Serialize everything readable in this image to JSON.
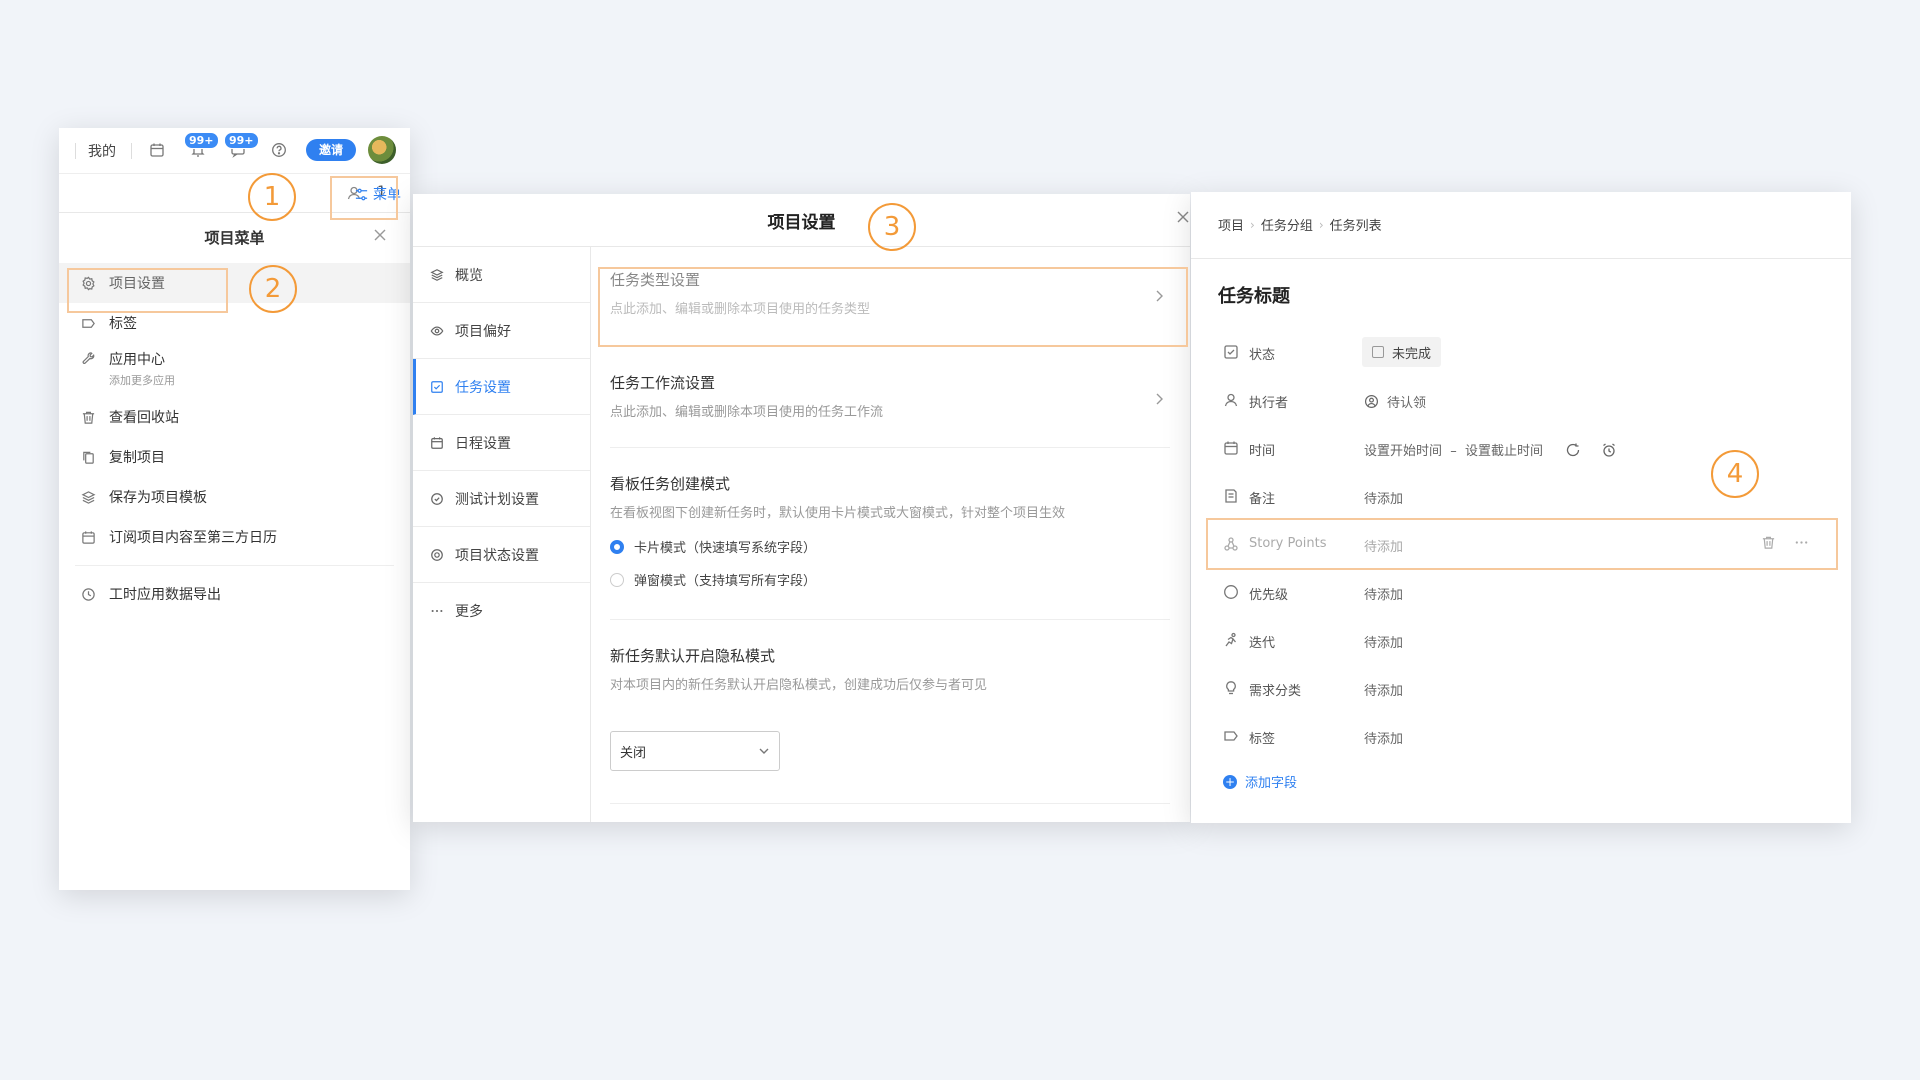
{
  "topbar": {
    "mine_label": "我的",
    "badge1": "99+",
    "badge2": "99+",
    "invite_label": "邀请"
  },
  "subbar": {
    "member_count": "1",
    "menu_label": "菜单"
  },
  "project_menu": {
    "title": "项目菜单",
    "items": [
      {
        "label": "项目设置",
        "icon": "gear-icon"
      },
      {
        "label": "标签",
        "icon": "tag-icon"
      },
      {
        "label": "应用中心",
        "sub": "添加更多应用",
        "icon": "wrench-icon"
      },
      {
        "label": "查看回收站",
        "icon": "trash-icon"
      },
      {
        "label": "复制项目",
        "icon": "copy-icon"
      },
      {
        "label": "保存为项目模板",
        "icon": "layers-icon"
      },
      {
        "label": "订阅项目内容至第三方日历",
        "icon": "calendar-icon"
      },
      {
        "label": "工时应用数据导出",
        "icon": "clock-icon"
      }
    ]
  },
  "settings": {
    "title": "项目设置",
    "nav": [
      {
        "label": "概览",
        "icon": "layers-icon"
      },
      {
        "label": "项目偏好",
        "icon": "eye-icon"
      },
      {
        "label": "任务设置",
        "icon": "checkbox-icon"
      },
      {
        "label": "日程设置",
        "icon": "calendar-icon"
      },
      {
        "label": "测试计划设置",
        "icon": "check-circle-icon"
      },
      {
        "label": "项目状态设置",
        "icon": "target-icon"
      },
      {
        "label": "更多",
        "icon": "more-icon"
      }
    ],
    "sections": {
      "task_type": {
        "title": "任务类型设置",
        "desc": "点此添加、编辑或删除本项目使用的任务类型"
      },
      "workflow": {
        "title": "任务工作流设置",
        "desc": "点此添加、编辑或删除本项目使用的任务工作流"
      },
      "kanban": {
        "title": "看板任务创建模式",
        "desc": "在看板视图下创建新任务时，默认使用卡片模式或大窗模式，针对整个项目生效",
        "option1": "卡片模式（快速填写系统字段）",
        "option2": "弹窗模式（支持填写所有字段）"
      },
      "privacy": {
        "title": "新任务默认开启隐私模式",
        "desc": "对本项目内的新任务默认开启隐私模式，创建成功后仅参与者可见",
        "select_value": "关闭"
      }
    }
  },
  "task": {
    "breadcrumb": [
      "项目",
      "任务分组",
      "任务列表"
    ],
    "title": "任务标题",
    "fields": {
      "status": {
        "label": "状态",
        "value": "未完成"
      },
      "assignee": {
        "label": "执行者",
        "value": "待认领"
      },
      "time": {
        "label": "时间",
        "value": "设置开始时间  –  设置截止时间"
      },
      "note": {
        "label": "备注",
        "value": "待添加"
      },
      "story_points": {
        "label": "Story Points",
        "value": "待添加"
      },
      "priority": {
        "label": "优先级",
        "value": "待添加"
      },
      "iteration": {
        "label": "迭代",
        "value": "待添加"
      },
      "requirement": {
        "label": "需求分类",
        "value": "待添加"
      },
      "tag": {
        "label": "标签",
        "value": "待添加"
      }
    },
    "add_field_label": "添加字段"
  },
  "markers": [
    "1",
    "2",
    "3",
    "4"
  ],
  "colors": {
    "accent": "#2f80f0",
    "annotation": "#f39a38",
    "highlight": "#f6c89c",
    "background": "#f1f4f9"
  }
}
